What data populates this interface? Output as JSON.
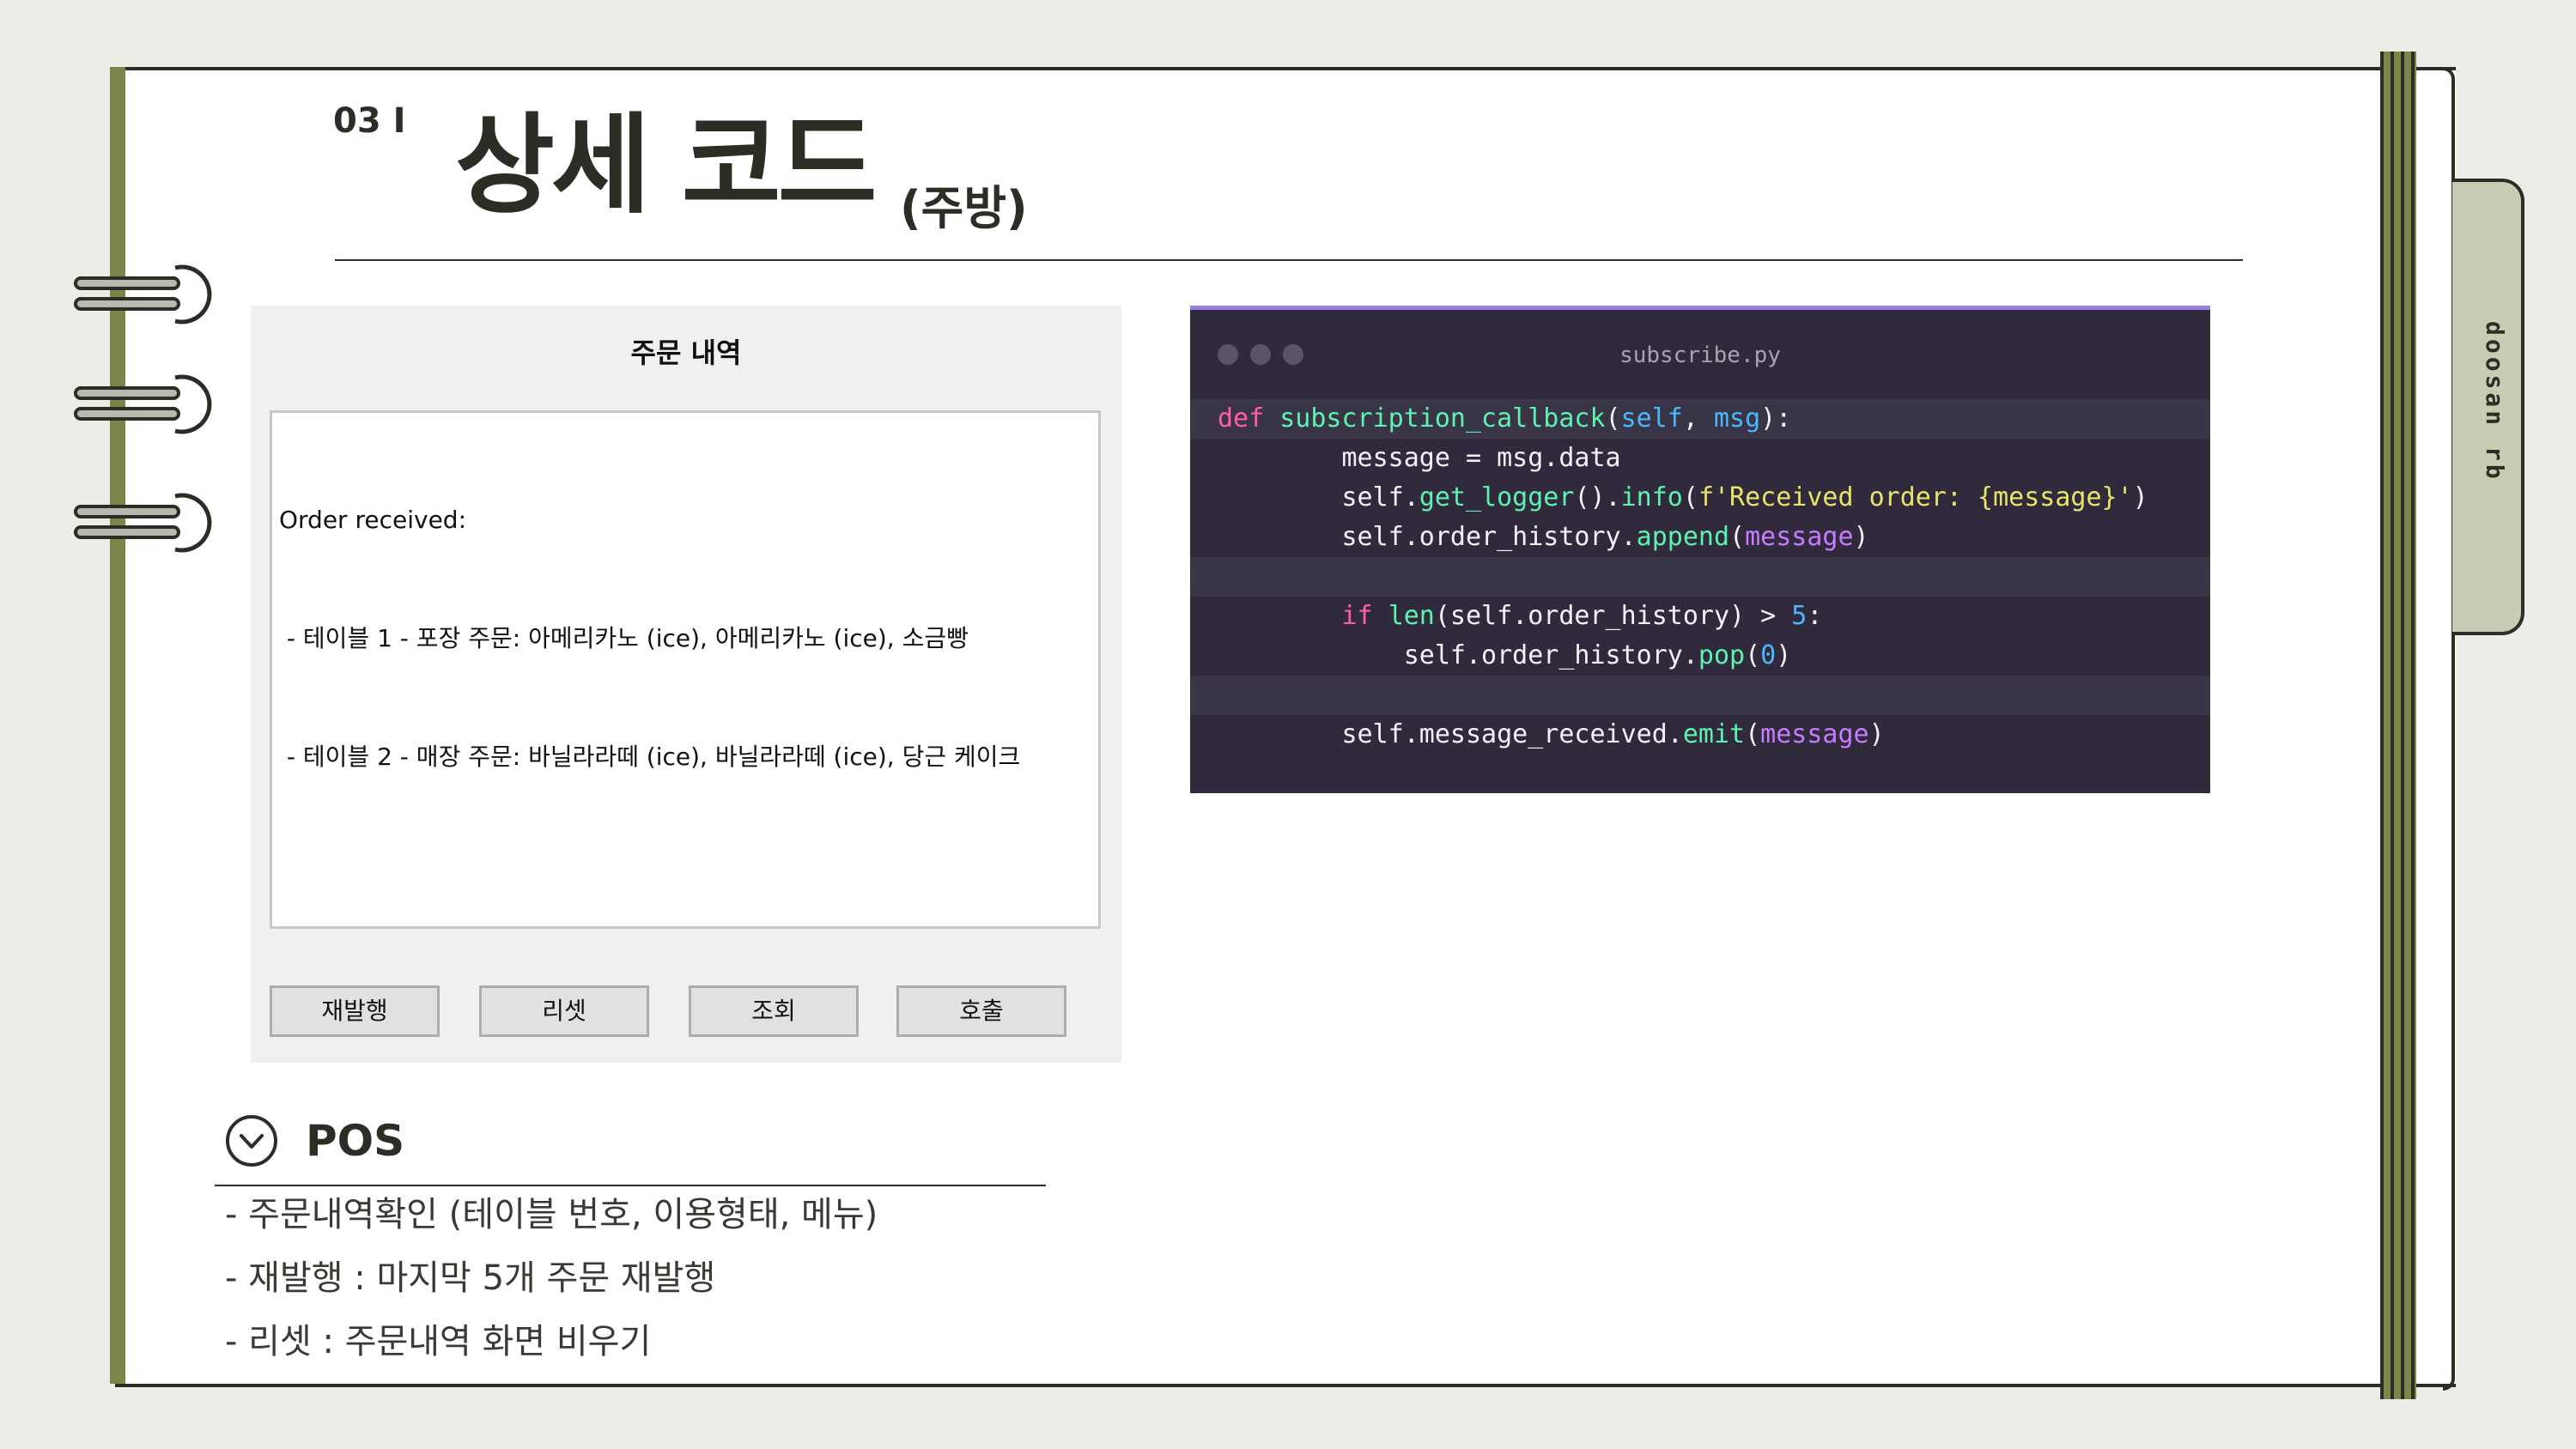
{
  "slide": {
    "section_number": "03 I",
    "title": "상세 코드",
    "subtitle": "(주방)",
    "side_tab": "doosan rb"
  },
  "dialog": {
    "title": "주문 내역",
    "order_lines": [
      "Order received:",
      " - 테이블 1 - 포장 주문: 아메리카노 (ice), 아메리카노 (ice), 소금빵",
      " - 테이블 2 - 매장 주문: 바닐라라떼 (ice), 바닐라라떼 (ice), 당근 케이크"
    ],
    "buttons": [
      "재발행",
      "리셋",
      "조회",
      "호출"
    ]
  },
  "code_window": {
    "filename": "subscribe.py",
    "lines": [
      "def subscription_callback(self, msg):",
      "        message = msg.data",
      "        self.get_logger().info(f'Received order: {message}')",
      "        self.order_history.append(message)",
      "",
      "        if len(self.order_history) > 5:",
      "            self.order_history.pop(0)",
      "",
      "        self.message_received.emit(message)"
    ]
  },
  "pos": {
    "title": "POS",
    "items": [
      "- 주문내역확인 (테이블 번호, 이용형태, 메뉴)",
      "- 재발행 : 마지막 5개 주문 재발행",
      "- 리셋 : 주문내역 화면 비우기"
    ]
  },
  "colors": {
    "background": "#edece6",
    "accent_olive": "#7a8549",
    "ink": "#2d2d26",
    "code_bg": "#302a3c",
    "code_top_border": "#9a7ee0"
  }
}
